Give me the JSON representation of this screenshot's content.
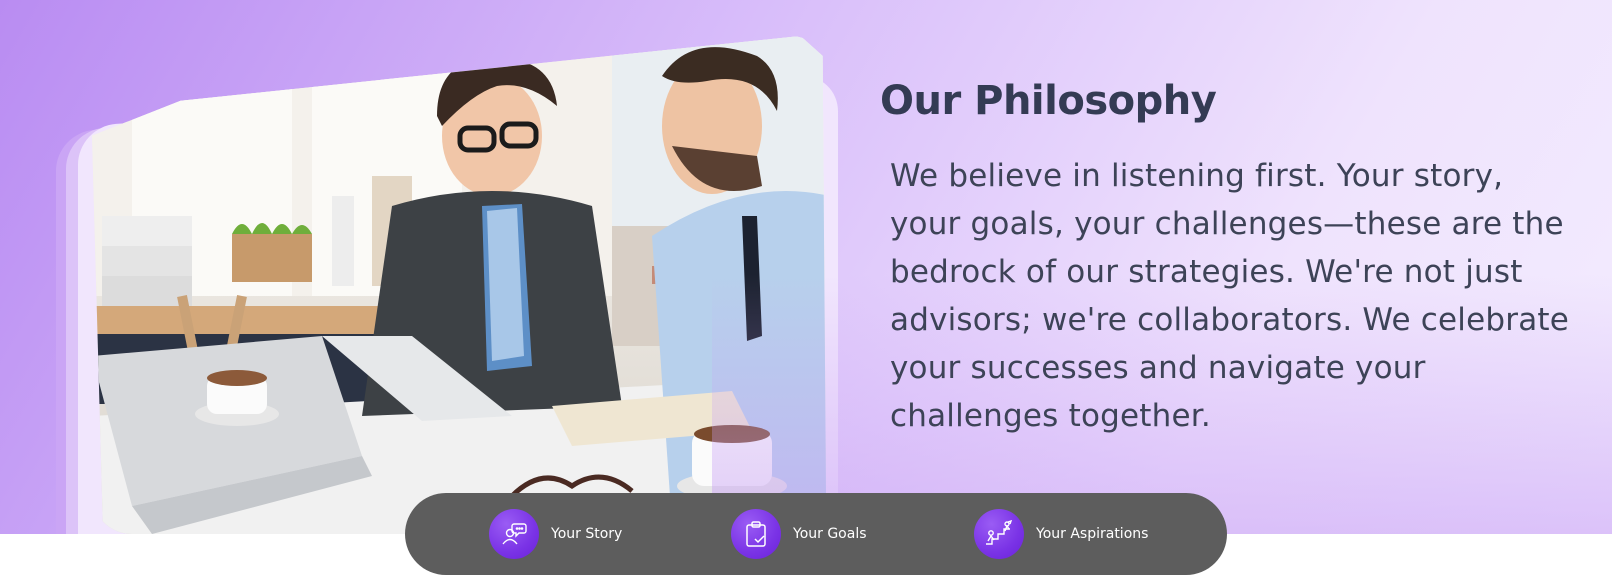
{
  "section": {
    "title": "Our Philosophy",
    "paragraph": "We believe in listening first. Your story, your goals, your challenges—these are the bedrock of our strategies. We're not just advisors; we're collaborators. We celebrate your successes and navigate your challenges together."
  },
  "photo": {
    "alt": "Two business professionals having a consultation at a desk"
  },
  "pill_nav": {
    "items": [
      {
        "label": "Your Story",
        "icon": "people-chat-icon"
      },
      {
        "label": "Your Goals",
        "icon": "clipboard-check-icon"
      },
      {
        "label": "Your Aspirations",
        "icon": "growth-steps-icon"
      }
    ]
  },
  "colors": {
    "title": "#343b54",
    "text": "#3d4357",
    "accent": "#7a33e6",
    "pill_bg": "#5d5d5d",
    "hero_gradient_start": "#b98cf2",
    "hero_gradient_end": "#f3ecfe"
  }
}
